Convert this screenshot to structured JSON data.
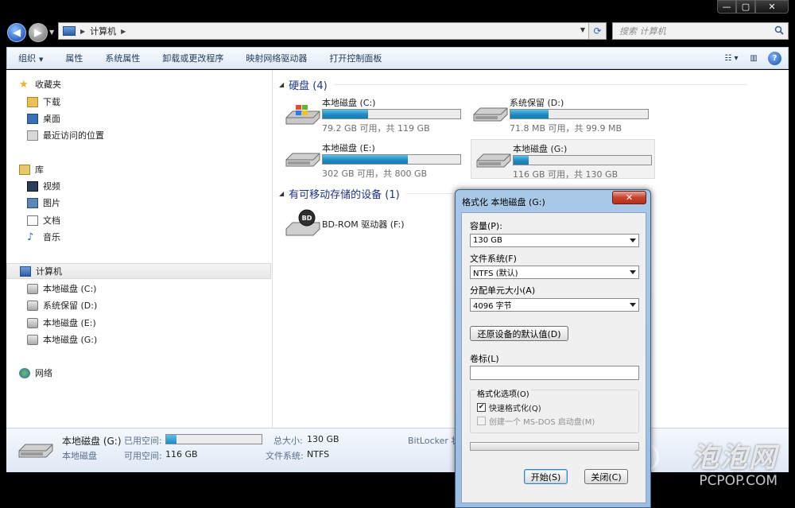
{
  "window": {
    "caption_buttons": [
      "—",
      "▢",
      "✕"
    ]
  },
  "address": {
    "crumbs": [
      "计算机"
    ],
    "search_placeholder": "搜索 计算机"
  },
  "toolbar": {
    "items": [
      "组织",
      "属性",
      "系统属性",
      "卸载或更改程序",
      "映射网络驱动器",
      "打开控制面板"
    ]
  },
  "nav": {
    "favorites_label": "收藏夹",
    "favorites": [
      "下载",
      "桌面",
      "最近访问的位置"
    ],
    "library_label": "库",
    "libraries": [
      "视频",
      "图片",
      "文档",
      "音乐"
    ],
    "computer_label": "计算机",
    "drives": [
      "本地磁盘 (C:)",
      "系统保留 (D:)",
      "本地磁盘 (E:)",
      "本地磁盘 (G:)"
    ],
    "network_label": "网络"
  },
  "content": {
    "hdd_group": "硬盘 (4)",
    "hdd": [
      {
        "name": "本地磁盘 (C:)",
        "free": "79.2 GB 可用，共 119 GB",
        "used_fraction": 0.33
      },
      {
        "name": "系统保留 (D:)",
        "free": "71.8 MB 可用，共 99.9 MB",
        "used_fraction": 0.28
      },
      {
        "name": "本地磁盘 (E:)",
        "free": "302 GB 可用，共 800 GB",
        "used_fraction": 0.62
      },
      {
        "name": "本地磁盘 (G:)",
        "free": "116 GB 可用，共 130 GB",
        "used_fraction": 0.11
      }
    ],
    "removable_group": "有可移动存储的设备 (1)",
    "removable": [
      {
        "name": "BD-ROM 驱动器 (F:)"
      }
    ]
  },
  "details": {
    "name": "本地磁盘 (G:)",
    "type": "本地磁盘",
    "used_label": "已用空间:",
    "used_fraction": 0.11,
    "free_label": "可用空间:",
    "free_value": "116 GB",
    "total_label": "总大小:",
    "total_value": "130 GB",
    "fs_label": "文件系统:",
    "fs_value": "NTFS",
    "bitlocker": "BitLocker 状"
  },
  "dialog": {
    "title": "格式化 本地磁盘 (G:)",
    "close": "✕",
    "capacity_label": "容量(P):",
    "capacity_value": "130 GB",
    "fs_label": "文件系统(F)",
    "fs_value": "NTFS (默认)",
    "alloc_label": "分配单元大小(A)",
    "alloc_value": "4096 字节",
    "restore_button": "还原设备的默认值(D)",
    "volume_label": "卷标(L)",
    "volume_value": "",
    "options_label": "格式化选项(O)",
    "quick_format": "快速格式化(Q)",
    "quick_format_checked": true,
    "msdos": "创建一个 MS-DOS 启动盘(M)",
    "msdos_checked": false,
    "start_button": "开始(S)",
    "close_button": "关闭(C)"
  },
  "watermark": {
    "cn": "泡泡网",
    "en": "PCPOP.COM"
  },
  "colors": {
    "bar_fill": "#1c8bc2",
    "group_header": "#1e3287",
    "dialog_frame": "#a9c8e8"
  }
}
